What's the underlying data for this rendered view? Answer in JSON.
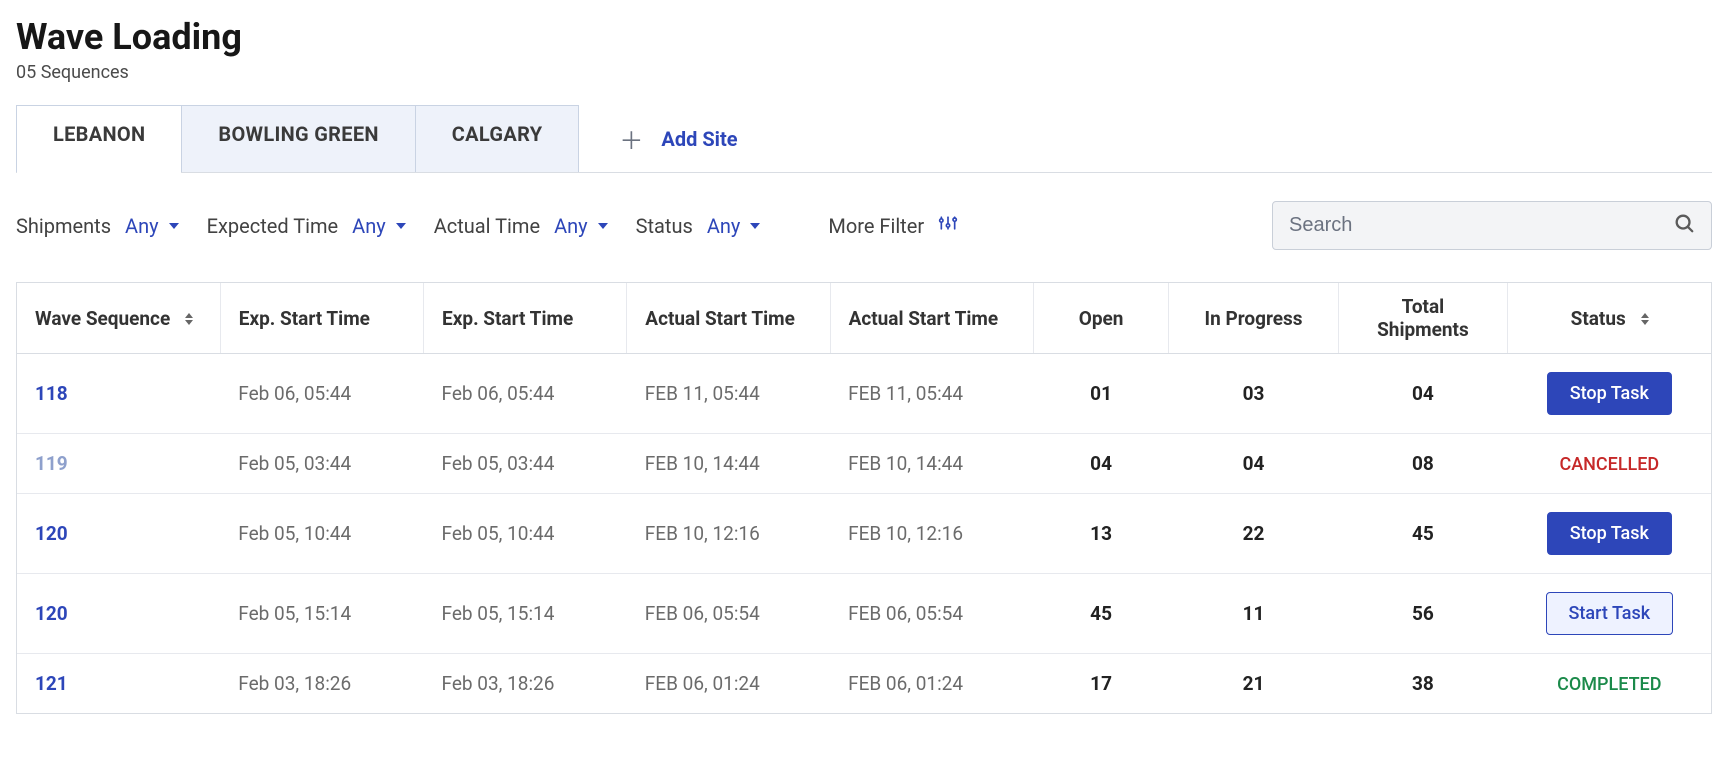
{
  "header": {
    "title": "Wave Loading",
    "subtitle": "05 Sequences"
  },
  "tabs": [
    {
      "label": "LEBANON",
      "active": true
    },
    {
      "label": "BOWLING GREEN",
      "active": false
    },
    {
      "label": "CALGARY",
      "active": false
    }
  ],
  "add_site_label": "Add Site",
  "filters": {
    "shipments": {
      "label": "Shipments",
      "value": "Any"
    },
    "expected_time": {
      "label": "Expected Time",
      "value": "Any"
    },
    "actual_time": {
      "label": "Actual Time",
      "value": "Any"
    },
    "status": {
      "label": "Status",
      "value": "Any"
    },
    "more_label": "More Filter"
  },
  "search": {
    "placeholder": "Search"
  },
  "columns": {
    "wave_sequence": "Wave Sequence",
    "exp_start_1": "Exp. Start Time",
    "exp_start_2": "Exp. Start Time",
    "actual_start_1": "Actual Start Time",
    "actual_start_2": "Actual Start Time",
    "open": "Open",
    "in_progress": "In Progress",
    "total_shipments": "Total Shipments",
    "status": "Status"
  },
  "rows": [
    {
      "seq": "118",
      "muted": false,
      "exp1": "Feb 06, 05:44",
      "exp2": "Feb 06, 05:44",
      "act1": "FEB 11, 05:44",
      "act2": "FEB 11, 05:44",
      "open": "01",
      "in_progress": "03",
      "total": "04",
      "status_type": "stop",
      "status_label": "Stop Task"
    },
    {
      "seq": "119",
      "muted": true,
      "exp1": "Feb 05, 03:44",
      "exp2": "Feb 05, 03:44",
      "act1": "FEB 10, 14:44",
      "act2": "FEB 10, 14:44",
      "open": "04",
      "in_progress": "04",
      "total": "08",
      "status_type": "cancelled",
      "status_label": "CANCELLED"
    },
    {
      "seq": "120",
      "muted": false,
      "exp1": "Feb 05, 10:44",
      "exp2": "Feb 05, 10:44",
      "act1": "FEB 10, 12:16",
      "act2": "FEB 10, 12:16",
      "open": "13",
      "in_progress": "22",
      "total": "45",
      "status_type": "stop",
      "status_label": "Stop Task"
    },
    {
      "seq": "120",
      "muted": false,
      "exp1": "Feb 05, 15:14",
      "exp2": "Feb 05, 15:14",
      "act1": "FEB 06, 05:54",
      "act2": "FEB 06, 05:54",
      "open": "45",
      "in_progress": "11",
      "total": "56",
      "status_type": "start",
      "status_label": "Start Task"
    },
    {
      "seq": "121",
      "muted": false,
      "exp1": "Feb 03, 18:26",
      "exp2": "Feb 03, 18:26",
      "act1": "FEB 06, 01:24",
      "act2": "FEB 06, 01:24",
      "open": "17",
      "in_progress": "21",
      "total": "38",
      "status_type": "completed",
      "status_label": "COMPLETED"
    }
  ]
}
